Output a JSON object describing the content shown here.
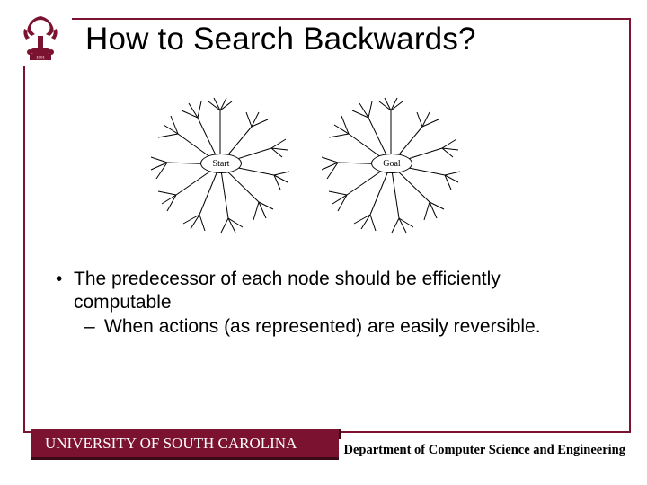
{
  "title": "How to Search Backwards?",
  "figure": {
    "left_label": "Start",
    "right_label": "Goal"
  },
  "bullets": {
    "main": "The predecessor of each node should be efficiently computable",
    "sub": "When actions (as represented) are easily reversible."
  },
  "footer": {
    "left": "UNIVERSITY OF SOUTH CAROLINA",
    "right": "Department of Computer Science and Engineering"
  }
}
